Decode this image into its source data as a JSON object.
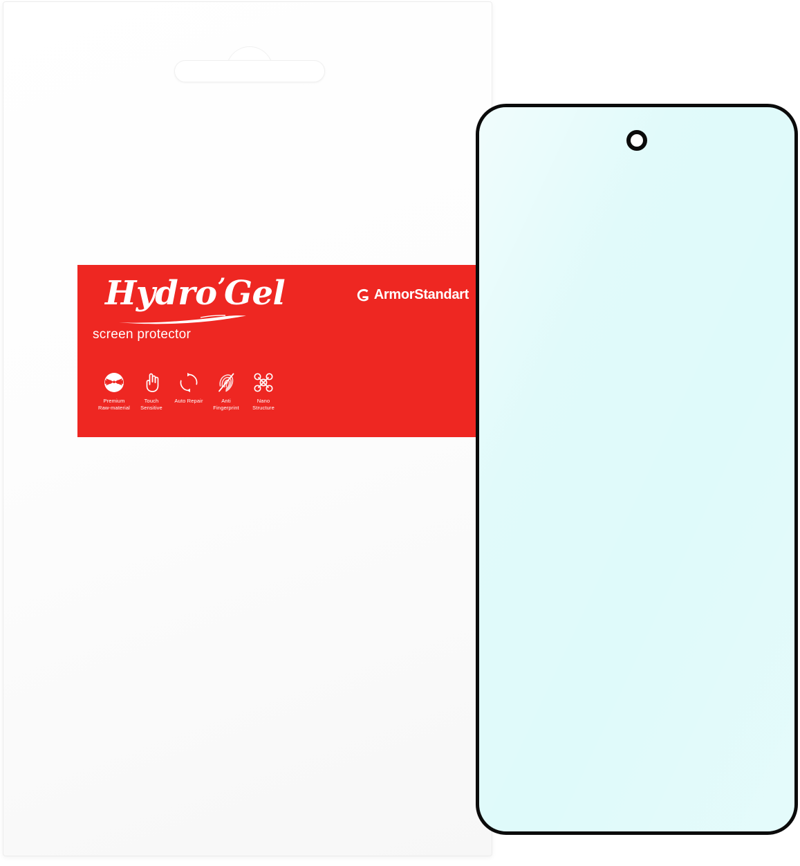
{
  "product": {
    "type": "screen-protector-product-photo",
    "background_color": "#ffffff"
  },
  "package": {
    "name": "retail-package-card",
    "background_color": "#ffffff",
    "border_color": "#ececec",
    "hang_slot": "euro-slot-hang-hole"
  },
  "label": {
    "background_color": "#ee2722",
    "brand_name": "Hydro",
    "brand_apostrophe": "’",
    "brand_name_2": "Gel",
    "tagline": "screen protector",
    "maker_name": "ArmorStandart",
    "maker_logo_icon": "armorstandart-c-mark-icon",
    "text_color": "#ffffff"
  },
  "features": [
    {
      "icon": "premium-raw-material-icon",
      "line1": "Premium",
      "line2": "Raw-material"
    },
    {
      "icon": "touch-sensitive-hand-icon",
      "line1": "Touch",
      "line2": "Sensitive"
    },
    {
      "icon": "auto-repair-circular-arrows-icon",
      "line1": "Auto Repair",
      "line2": ""
    },
    {
      "icon": "anti-fingerprint-icon",
      "line1": "Anti",
      "line2": "Fingerprint"
    },
    {
      "icon": "nano-structure-icon",
      "line1": "Nano",
      "line2": "Structure"
    }
  ],
  "protector": {
    "name": "hydrogel-screen-protector-film",
    "fill_color": "#dffafa",
    "border_color": "#0b0b0b",
    "camera_cutout": "punch-hole-camera-cutout"
  }
}
